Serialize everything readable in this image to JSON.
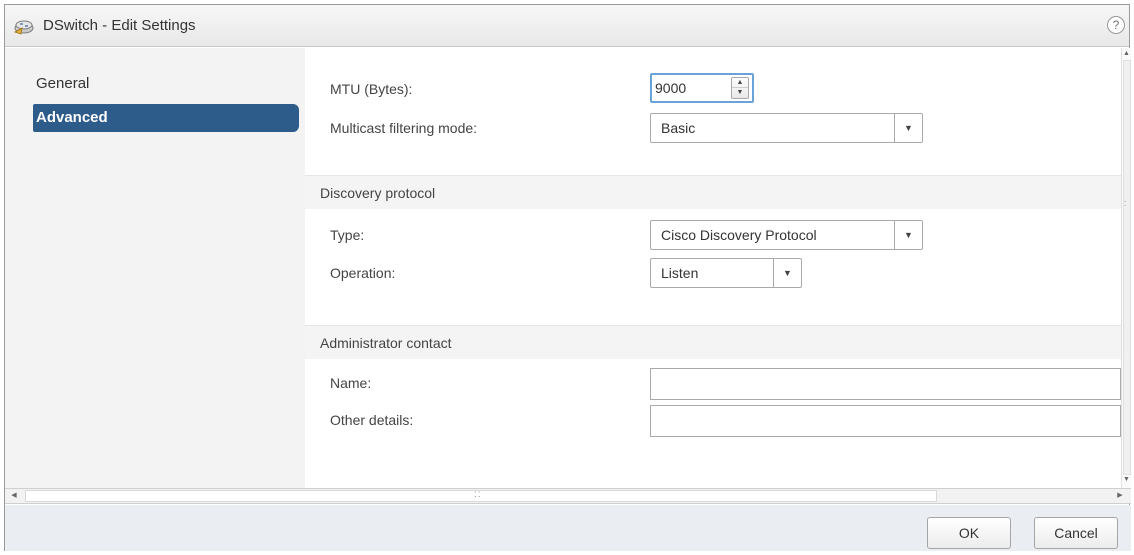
{
  "window": {
    "title": "DSwitch - Edit Settings",
    "help_glyph": "?"
  },
  "sidebar": {
    "items": [
      {
        "label": "General",
        "active": false
      },
      {
        "label": "Advanced",
        "active": true
      }
    ]
  },
  "form": {
    "mtu": {
      "label": "MTU (Bytes):",
      "value": "9000"
    },
    "multicast": {
      "label": "Multicast filtering mode:",
      "value": "Basic"
    },
    "discovery": {
      "section_title": "Discovery protocol",
      "type": {
        "label": "Type:",
        "value": "Cisco Discovery Protocol"
      },
      "operation": {
        "label": "Operation:",
        "value": "Listen"
      }
    },
    "admin": {
      "section_title": "Administrator contact",
      "name": {
        "label": "Name:",
        "value": ""
      },
      "other": {
        "label": "Other details:",
        "value": ""
      }
    }
  },
  "footer": {
    "ok_label": "OK",
    "cancel_label": "Cancel"
  },
  "colors": {
    "accent": "#2d5b8a",
    "focus_border": "#6aa3d9",
    "footer_bg": "#eaeef3"
  },
  "icons": [
    "switch-icon",
    "help-icon",
    "spin-up-icon",
    "spin-down-icon",
    "dropdown-arrow-icon",
    "scroll-arrow-icon"
  ]
}
